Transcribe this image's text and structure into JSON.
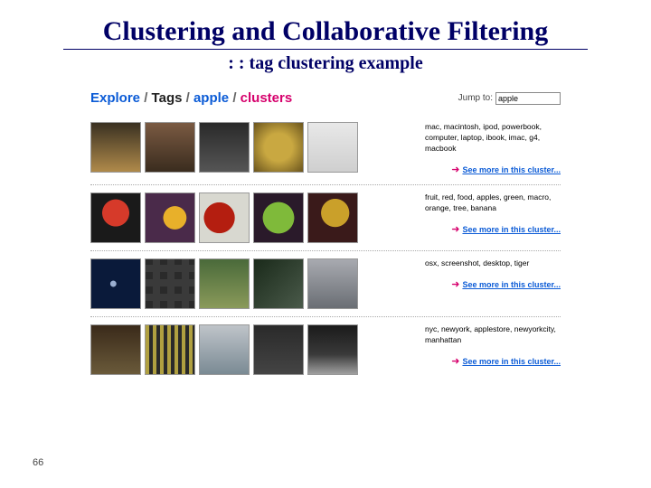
{
  "title": "Clustering and Collaborative Filtering",
  "subtitle": ": : tag clustering example",
  "page_number": "66",
  "breadcrumb": {
    "explore": "Explore",
    "sep": "/",
    "tags": "Tags",
    "apple": "apple",
    "clusters": "clusters"
  },
  "jump": {
    "label": "Jump to:",
    "value": "apple"
  },
  "see_more_label": "See more in this cluster...",
  "clusters": [
    {
      "tags": "mac, macintosh, ipod, powerbook, computer, laptop, ibook, imac, g4, macbook"
    },
    {
      "tags": "fruit, red, food, apples, green, macro, orange, tree, banana"
    },
    {
      "tags": "osx, screenshot, desktop, tiger"
    },
    {
      "tags": "nyc, newyork, applestore, newyorkcity, manhattan"
    }
  ]
}
